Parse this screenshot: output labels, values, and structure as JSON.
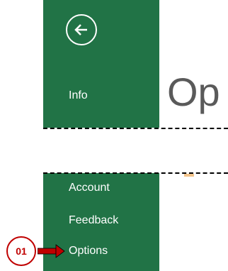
{
  "sidebar": {
    "items": [
      {
        "label": "Info"
      },
      {
        "label": "Account"
      },
      {
        "label": "Feedback"
      },
      {
        "label": "Options"
      }
    ]
  },
  "main": {
    "title_partial": "Op"
  },
  "annotation": {
    "step_label": "01",
    "color": "#c00000"
  },
  "colors": {
    "sidebar": "#217346",
    "text_on_sidebar": "#ffffff"
  },
  "icons": [
    "back-arrow-icon",
    "red-arrow-icon"
  ]
}
